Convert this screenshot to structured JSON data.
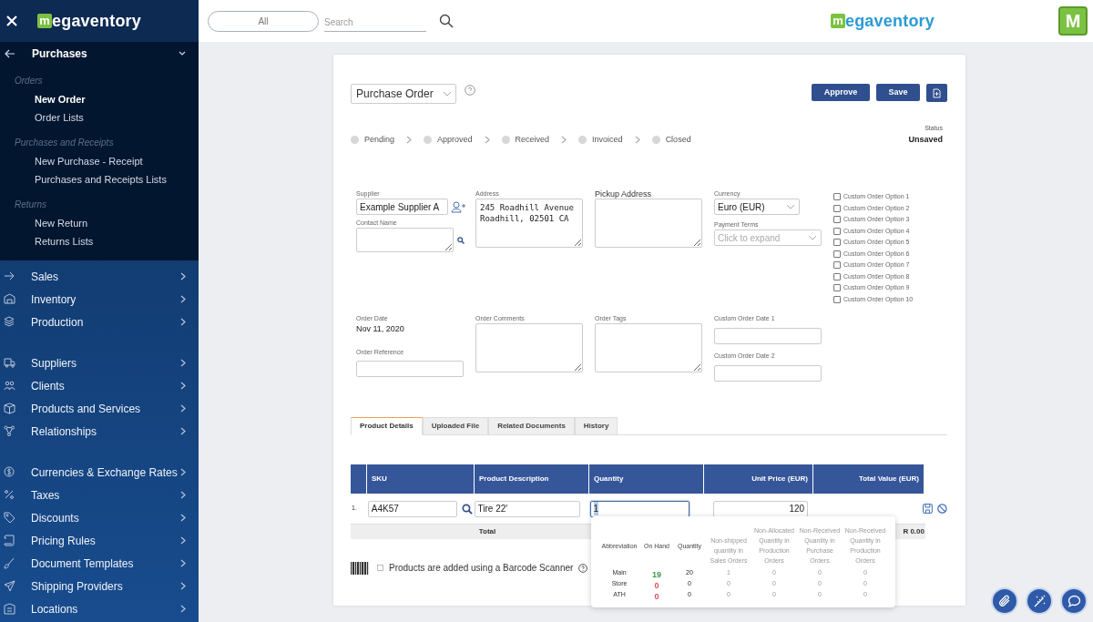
{
  "sidebar": {
    "logo": {
      "mark": "m",
      "text": "egaventory"
    },
    "section": {
      "title": "Purchases",
      "expanded": true,
      "groups": [
        {
          "title": "Orders",
          "items": [
            {
              "label": "New Order",
              "selected": true
            },
            {
              "label": "Order Lists",
              "selected": false
            }
          ]
        },
        {
          "title": "Purchases and Receipts",
          "items": [
            {
              "label": "New Purchase - Receipt",
              "selected": false
            },
            {
              "label": "Purchases and Receipts Lists",
              "selected": false
            }
          ]
        },
        {
          "title": "Returns",
          "items": [
            {
              "label": "New Return",
              "selected": false
            },
            {
              "label": "Returns Lists",
              "selected": false
            }
          ]
        }
      ]
    },
    "menu": [
      [
        {
          "label": "Sales"
        },
        {
          "label": "Inventory"
        },
        {
          "label": "Production"
        }
      ],
      [
        {
          "label": "Suppliers"
        },
        {
          "label": "Clients"
        },
        {
          "label": "Products and Services"
        },
        {
          "label": "Relationships"
        }
      ],
      [
        {
          "label": "Currencies & Exchange Rates"
        },
        {
          "label": "Taxes"
        },
        {
          "label": "Discounts"
        },
        {
          "label": "Pricing Rules"
        },
        {
          "label": "Document Templates"
        },
        {
          "label": "Shipping Providers"
        },
        {
          "label": "Locations"
        }
      ]
    ]
  },
  "header": {
    "filter": "All",
    "search_placeholder": "Search",
    "logo": {
      "mark": "m",
      "text": "egaventory"
    },
    "app_icon": "M"
  },
  "document": {
    "type": "Purchase Order",
    "buttons": [
      "Approve",
      "Save"
    ],
    "steps": [
      "Pending",
      "Approved",
      "Received",
      "Invoiced",
      "Closed"
    ],
    "status": {
      "label": "Status",
      "value": "Unsaved"
    }
  },
  "form": {
    "supplier": {
      "label": "Supplier",
      "value": "Example Supplier A"
    },
    "contact_name": {
      "label": "Contact Name"
    },
    "address": {
      "label": "Address",
      "value": "245 Roadhill Avenue\nRoadhill, 02501 CA"
    },
    "pickup_address": {
      "label": "Pickup Address"
    },
    "currency": {
      "label": "Currency",
      "value": "Euro (EUR)"
    },
    "payment_terms": {
      "label": "Payment Terms",
      "placeholder": "Click to expand"
    },
    "custom_options": [
      {
        "label": "Custom Order Option 1",
        "checked": false
      },
      {
        "label": "Custom Order Option 2",
        "checked": false
      },
      {
        "label": "Custom Order Option 3",
        "checked": false
      },
      {
        "label": "Custom Order Option 4",
        "checked": false
      },
      {
        "label": "Custom Order Option 5",
        "checked": false
      },
      {
        "label": "Custom Order Option 6",
        "checked": false
      },
      {
        "label": "Custom Order Option 7",
        "checked": false
      },
      {
        "label": "Custom Order Option 8",
        "checked": false
      },
      {
        "label": "Custom Order Option 9",
        "checked": false
      },
      {
        "label": "Custom Order Option 10",
        "checked": false
      }
    ],
    "order_date": {
      "label": "Order Date",
      "value": "Nov 11, 2020"
    },
    "order_reference": {
      "label": "Order Reference"
    },
    "order_comments": {
      "label": "Order Comments"
    },
    "order_tags": {
      "label": "Order Tags"
    },
    "custom_date_1": {
      "label": "Custom Order Date 1"
    },
    "custom_date_2": {
      "label": "Custom Order Date 2"
    }
  },
  "tabs": [
    {
      "label": "Product Details",
      "selected": true
    },
    {
      "label": "Uploaded File",
      "selected": false
    },
    {
      "label": "Related Documents",
      "selected": false
    },
    {
      "label": "History",
      "selected": false
    }
  ],
  "table": {
    "columns": [
      "SKU",
      "Product Description",
      "Quantity",
      "Unit Price (EUR)",
      "Total Value (EUR)"
    ],
    "rows": [
      {
        "number": "1.",
        "sku": "A4K57",
        "description": "Tire 22'",
        "quantity": "1",
        "quantity_focused": true,
        "unit_price": "120"
      }
    ],
    "total": {
      "label": "Total",
      "value": "R 0.00"
    }
  },
  "stock_popup": {
    "columns": [
      "Abbreviation",
      "On Hand",
      "Quantity",
      "Non-shipped quantity in Sales Orders",
      "Non-Allocated Quantity in Production Orders",
      "Non-Received Quantity in Purchase Orders",
      "Non-Received Quantity in Production Orders"
    ],
    "rows": [
      {
        "cells": [
          "Main",
          "19",
          "20",
          "1",
          "0",
          "0",
          "0"
        ],
        "color": "#3a9a4a"
      },
      {
        "cells": [
          "Store",
          "0",
          "0",
          "0",
          "0",
          "0",
          "0"
        ],
        "color": "#e0505a"
      },
      {
        "cells": [
          "ATH",
          "0",
          "0",
          "0",
          "0",
          "0",
          "0"
        ],
        "color": "#e0505a"
      }
    ]
  },
  "barcode": {
    "label": "Products are added using a Barcode Scanner",
    "checked": false
  }
}
